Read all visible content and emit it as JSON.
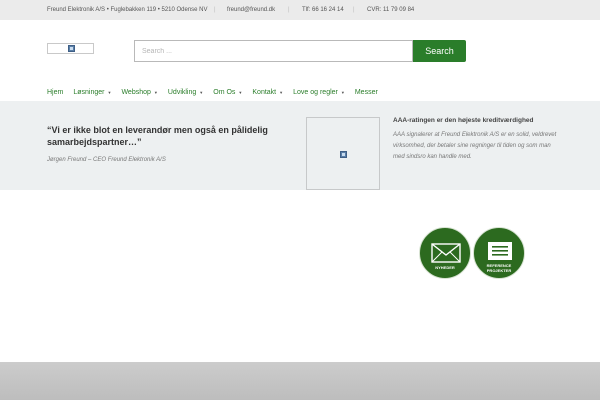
{
  "topbar": {
    "address": "Freund Elektronik A/S • Fuglebakken 119 • 5210 Odense NV",
    "email": "freund@freund.dk",
    "phone": "Tlf: 66 16 24 14",
    "cvr": "CVR: 11 79 09 84"
  },
  "search": {
    "placeholder": "Search ...",
    "button_label": "Search"
  },
  "nav": {
    "items": [
      {
        "label": "Hjem",
        "dropdown": false
      },
      {
        "label": "Løsninger",
        "dropdown": true
      },
      {
        "label": "Webshop",
        "dropdown": true
      },
      {
        "label": "Udvikling",
        "dropdown": true
      },
      {
        "label": "Om Os",
        "dropdown": true
      },
      {
        "label": "Kontakt",
        "dropdown": true
      },
      {
        "label": "Love og regler",
        "dropdown": true
      },
      {
        "label": "Messer",
        "dropdown": false
      }
    ],
    "caret": "▼"
  },
  "testimonial": {
    "quote": "“Vi er ikke blot en leverandør men også en pålidelig samarbejdspartner…”",
    "author": "Jørgen Freund – CEO Freund Elektronik A/S"
  },
  "aaa": {
    "title": "AAA-ratingen er den højeste kreditværdighed",
    "text": "AAA signalerer at Freund Elektronik A/S er en solid, veldrevet virksomhed, der betaler sine regninger til tiden og som man med sindsro kan handle med."
  },
  "circles": {
    "news_label": "NYHEDER",
    "reference_label_1": "REFERENCE",
    "reference_label_2": "PROJEKTER"
  },
  "colors": {
    "accent_green": "#2a7d2a",
    "circle_green": "#2c6a1f",
    "band_bg": "#edf0f1",
    "topbar_bg": "#ebebeb"
  }
}
